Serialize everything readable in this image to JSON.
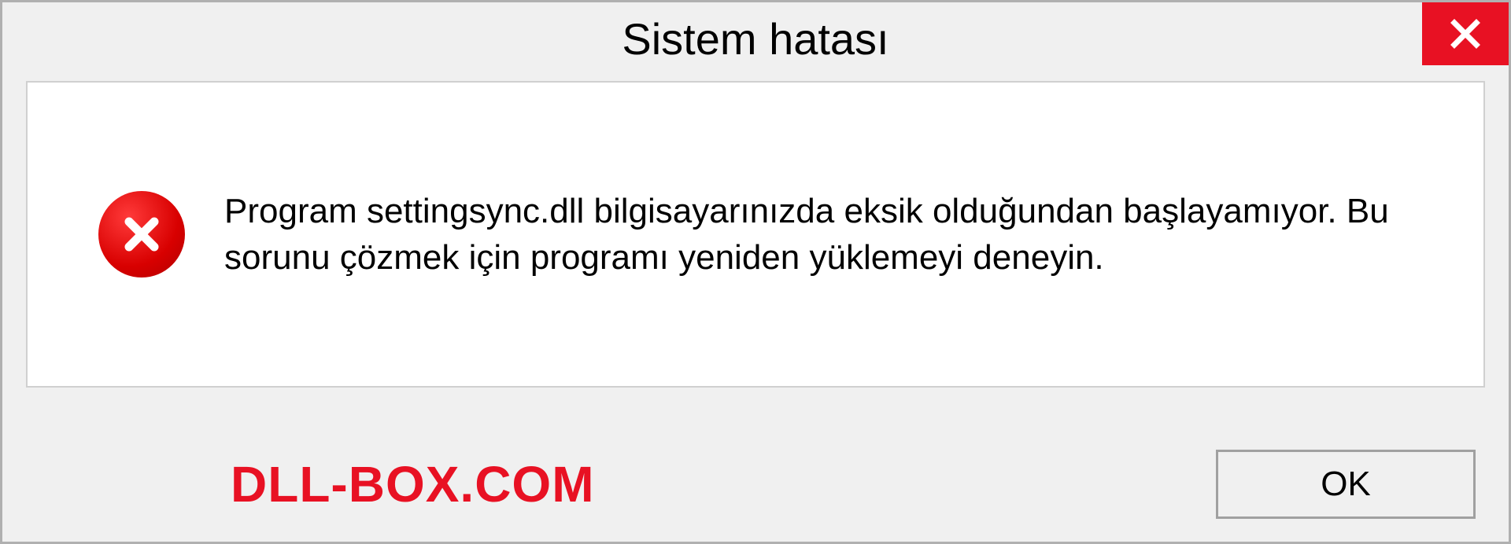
{
  "dialog": {
    "title": "Sistem hatası",
    "message": "Program settingsync.dll bilgisayarınızda eksik olduğundan başlayamıyor. Bu sorunu çözmek için programı yeniden yüklemeyi deneyin.",
    "ok_label": "OK"
  },
  "watermark": "DLL-BOX.COM"
}
